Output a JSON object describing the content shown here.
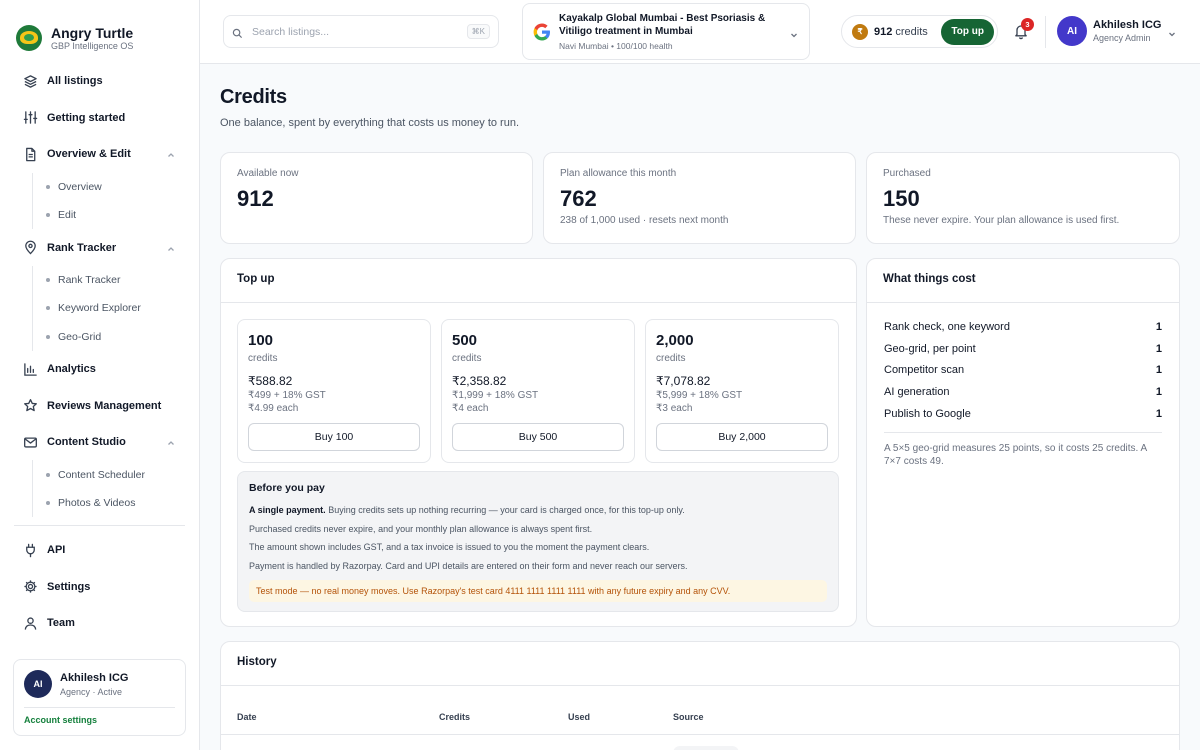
{
  "brand": {
    "name": "Angry Turtle",
    "tagline": "GBP Intelligence OS"
  },
  "nav": {
    "all_listings": "All listings",
    "getting_started": "Getting started",
    "overview_edit": "Overview & Edit",
    "overview_edit_sub": [
      "Overview",
      "Edit"
    ],
    "rank_tracker": "Rank Tracker",
    "rank_tracker_sub": [
      "Rank Tracker",
      "Keyword Explorer",
      "Geo-Grid"
    ],
    "analytics": "Analytics",
    "reviews": "Reviews Management",
    "content_studio": "Content Studio",
    "content_studio_sub": [
      "Content Scheduler",
      "Photos & Videos"
    ],
    "api": "API",
    "settings": "Settings",
    "team": "Team"
  },
  "user_card": {
    "initials": "AI",
    "name": "Akhilesh ICG",
    "role": "Agency · Active",
    "account_link": "Account settings"
  },
  "header": {
    "search_placeholder": "Search listings...",
    "search_shortcut": "⌘K",
    "business_name": "Kayakalp Global Mumbai - Best Psoriasis & Vitiligo treatment in Mumbai",
    "business_meta": "Navi Mumbai • 100/100 health",
    "credits_amount": "912",
    "credits_unit": "credits",
    "topup_label": "Top up",
    "notification_count": "3",
    "profile_initials": "AI",
    "profile_name": "Akhilesh ICG",
    "profile_role": "Agency Admin"
  },
  "page": {
    "title": "Credits",
    "subtitle": "One balance, spent by everything that costs us money to run."
  },
  "stats": [
    {
      "label": "Available now",
      "value": "912",
      "note": ""
    },
    {
      "label": "Plan allowance this month",
      "value": "762",
      "note": "238 of 1,000 used · resets next month"
    },
    {
      "label": "Purchased",
      "value": "150",
      "note": "These never expire. Your plan allowance is used first."
    }
  ],
  "topup": {
    "title": "Top up",
    "packages": [
      {
        "qty": "100",
        "unit": "credits",
        "price": "₹588.82",
        "base": "₹499 + 18% GST",
        "each": "₹4.99 each",
        "button": "Buy 100"
      },
      {
        "qty": "500",
        "unit": "credits",
        "price": "₹2,358.82",
        "base": "₹1,999 + 18% GST",
        "each": "₹4 each",
        "button": "Buy 500"
      },
      {
        "qty": "2,000",
        "unit": "credits",
        "price": "₹7,078.82",
        "base": "₹5,999 + 18% GST",
        "each": "₹3 each",
        "button": "Buy 2,000"
      }
    ],
    "before_title": "Before you pay",
    "before_lead_bold": "A single payment.",
    "before_lead_rest": " Buying credits sets up nothing recurring — your card is charged once, for this top-up only.",
    "before_lines": [
      "Purchased credits never expire, and your monthly plan allowance is always spent first.",
      "The amount shown includes GST, and a tax invoice is issued to you the moment the payment clears.",
      "Payment is handled by Razorpay. Card and UPI details are entered on their form and never reach our servers."
    ],
    "test_mode": "Test mode — no real money moves. Use Razorpay's test card 4111 1111 1111 1111 with any future expiry and any CVV."
  },
  "costs": {
    "title": "What things cost",
    "items": [
      {
        "label": "Rank check, one keyword",
        "cost": "1"
      },
      {
        "label": "Geo-grid, per point",
        "cost": "1"
      },
      {
        "label": "Competitor scan",
        "cost": "1"
      },
      {
        "label": "AI generation",
        "cost": "1"
      },
      {
        "label": "Publish to Google",
        "cost": "1"
      }
    ],
    "note": "A 5×5 geo-grid measures 25 points, so it costs 25 credits. A 7×7 costs 49."
  },
  "history": {
    "title": "History",
    "columns": [
      "Date",
      "Credits",
      "Used",
      "Source"
    ]
  },
  "colors": {
    "accent": "#166534",
    "coin": "#c07a10",
    "badge": "#dc2626",
    "avatar": "#4338ca"
  }
}
